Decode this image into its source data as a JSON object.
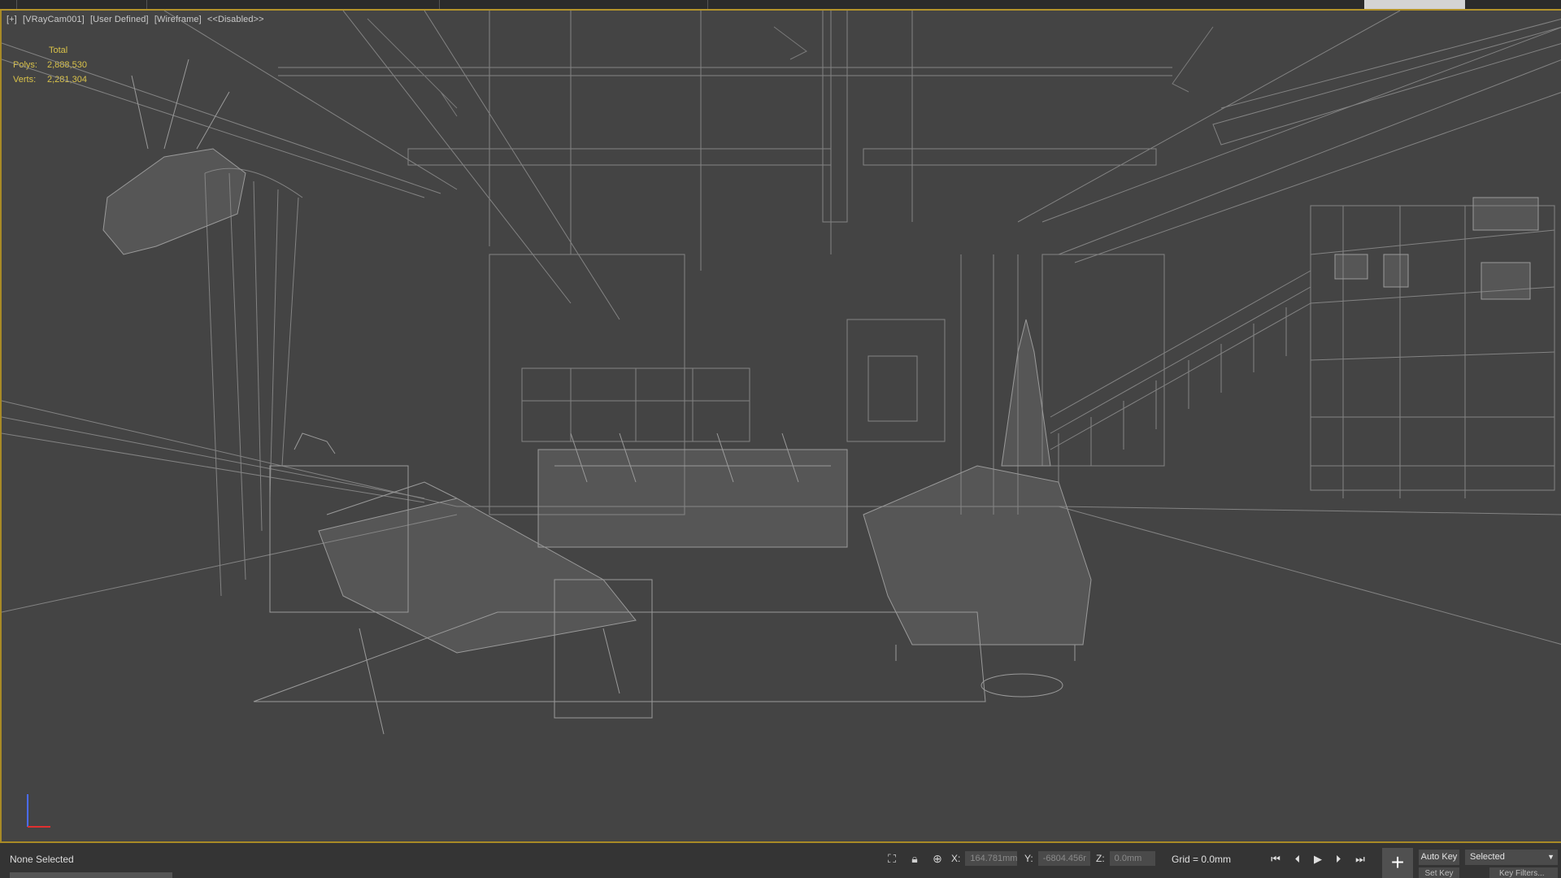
{
  "viewport": {
    "label_parts": [
      "[+]",
      "[VRayCam001]",
      "[User Defined]",
      "[Wireframe]",
      "<<Disabled>>"
    ],
    "stats": {
      "title": "Total",
      "polys_label": "Polys:",
      "polys_value": "2,888,530",
      "verts_label": "Verts:",
      "verts_value": "2,281,304"
    }
  },
  "statusbar": {
    "selection_text": "None Selected",
    "x_label": "X:",
    "x_value": "164.781mm",
    "y_label": "Y:",
    "y_value": "-6804.456r",
    "z_label": "Z:",
    "z_value": "0.0mm",
    "grid_text": "Grid = 0.0mm",
    "autokey_label": "Auto Key",
    "setkey_label": "Set Key",
    "selected_option": "Selected",
    "keyfilters_label": "Key Filters..."
  },
  "icons": {
    "isolate": "isolate-icon",
    "lock": "lock-icon",
    "absolute_mode": "absolute-mode-icon",
    "go_start": "go-to-start-icon",
    "prev_frame": "previous-frame-icon",
    "play": "play-icon",
    "next_frame": "next-frame-icon",
    "go_end": "go-to-end-icon",
    "set_key": "set-key-icon"
  },
  "colors": {
    "accent": "#a88a26",
    "stats": "#d9c24a",
    "viewport_bg": "#444444",
    "wire": "#8e8e8e"
  }
}
